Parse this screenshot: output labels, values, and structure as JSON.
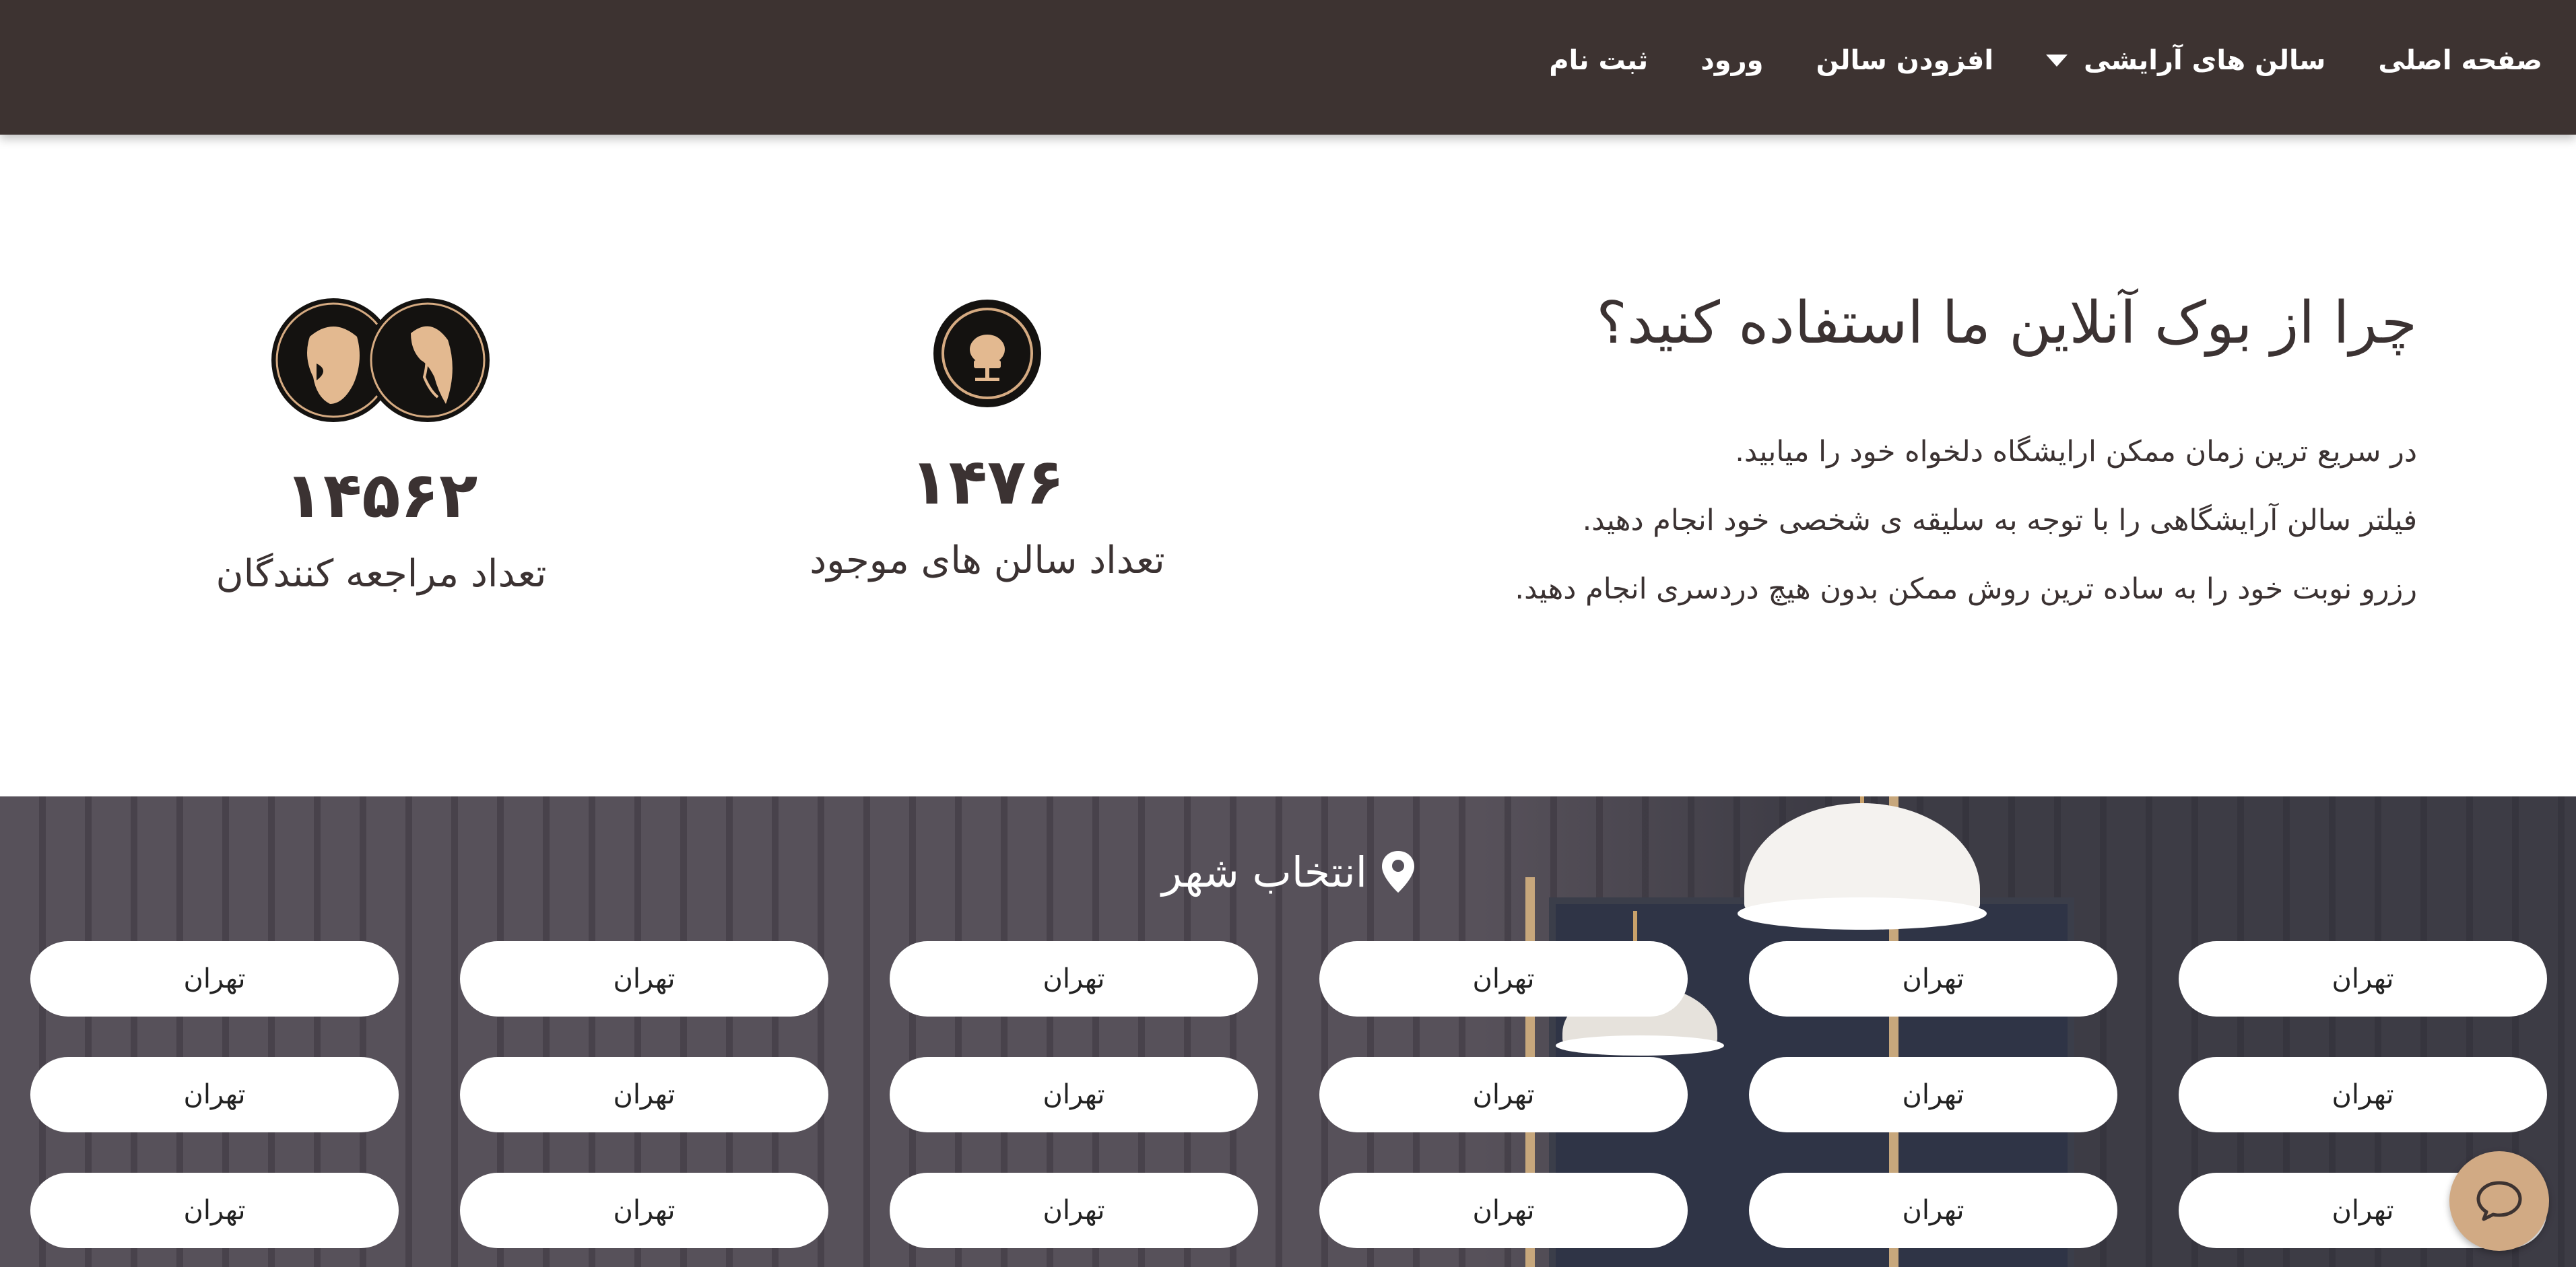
{
  "navbar": {
    "items": [
      {
        "label": "صفحه اصلی"
      },
      {
        "label": "سالن های آرایشی"
      },
      {
        "label": "افزودن سالن"
      },
      {
        "label": "ورود"
      },
      {
        "label": "ثبت نام"
      }
    ]
  },
  "why": {
    "title": "چرا از بوک آنلاین ما استفاده کنید؟",
    "lines": [
      "در سریع ترین زمان ممکن ارایشگاه دلخواه خود را میابید.",
      "فیلتر سالن آرایشگاهی را با توجه به سلیقه ی شخصی خود انجام دهید.",
      "رزرو نوبت خود را به ساده ترین روش ممکن بدون هیچ دردسری انجام دهید."
    ]
  },
  "stats": {
    "salons": {
      "number": "۱۴۷۶",
      "label": "تعداد سالن های موجود",
      "icon": "salon-chair-icon"
    },
    "visitors": {
      "number": "۱۴۵۶۲",
      "label": "تعداد مراجعه کنندگان",
      "icon": "man-woman-faces-icon"
    }
  },
  "cities": {
    "heading": "انتخاب شهر",
    "icon": "location-pin-icon",
    "items": [
      "تهران",
      "تهران",
      "تهران",
      "تهران",
      "تهران",
      "تهران",
      "تهران",
      "تهران",
      "تهران",
      "تهران",
      "تهران",
      "تهران",
      "تهران",
      "تهران",
      "تهران",
      "تهران",
      "تهران",
      "تهران"
    ]
  },
  "chat": {
    "icon": "chat-bubble-icon",
    "color": "#d1aa84"
  },
  "colors": {
    "navbar": "#3d3331",
    "accent": "#d1aa84",
    "text": "#3b3232"
  }
}
